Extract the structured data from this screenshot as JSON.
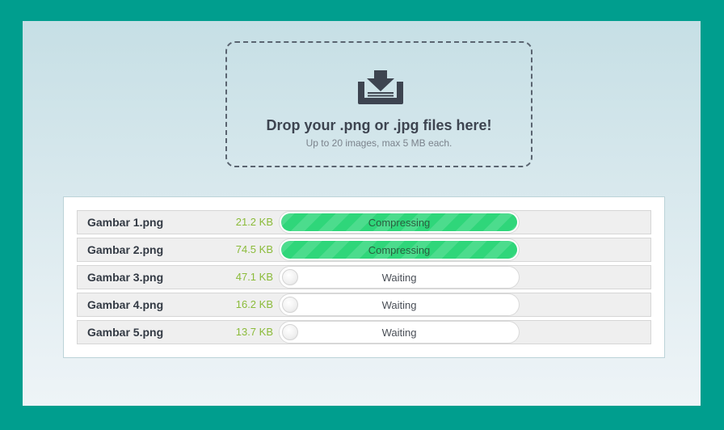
{
  "dropzone": {
    "title": "Drop your .png or .jpg files here!",
    "subtitle": "Up to 20 images, max 5 MB each.",
    "icon": "download-tray-icon"
  },
  "colors": {
    "frame": "#009e8e",
    "progress_fill": "#2fd67a",
    "file_size": "#8bbb3a"
  },
  "files": [
    {
      "name": "Gambar 1.png",
      "size": "21.2 KB",
      "status": "Compressing",
      "progress": 1.0
    },
    {
      "name": "Gambar 2.png",
      "size": "74.5 KB",
      "status": "Compressing",
      "progress": 1.0
    },
    {
      "name": "Gambar 3.png",
      "size": "47.1 KB",
      "status": "Waiting",
      "progress": 0
    },
    {
      "name": "Gambar 4.png",
      "size": "16.2 KB",
      "status": "Waiting",
      "progress": 0
    },
    {
      "name": "Gambar 5.png",
      "size": "13.7 KB",
      "status": "Waiting",
      "progress": 0
    }
  ]
}
